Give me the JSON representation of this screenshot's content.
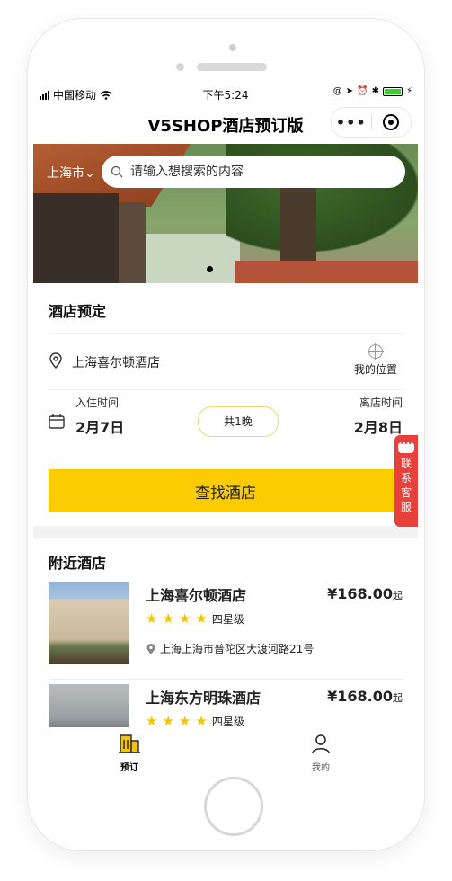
{
  "status_bar": {
    "carrier": "中国移动",
    "time": "下午5:24"
  },
  "navbar": {
    "title": "V5SHOP酒店预订版",
    "more_label": "•••"
  },
  "banner": {
    "city": "上海市",
    "search_placeholder": "请输入想搜索的内容"
  },
  "booking": {
    "section_title": "酒店预定",
    "hotel_name": "上海喜尔顿酒店",
    "my_location_label": "我的位置",
    "checkin_label": "入住时间",
    "checkin_date": "2月7日",
    "checkout_label": "离店时间",
    "checkout_date": "2月8日",
    "nights": "共1晚",
    "find_button": "查找酒店"
  },
  "nearby": {
    "section_title": "附近酒店",
    "hotels": [
      {
        "name": "上海喜尔顿酒店",
        "price": "¥168.00",
        "price_suffix": "起",
        "stars": 4,
        "grade": "四星级",
        "address": "上海上海市普陀区大渡河路21号"
      },
      {
        "name": "上海东方明珠酒店",
        "price": "¥168.00",
        "price_suffix": "起",
        "stars": 4,
        "grade": "四星级",
        "address": ""
      }
    ]
  },
  "tabbar": {
    "tabs": [
      {
        "label": "预订",
        "icon": "building-icon",
        "active": true
      },
      {
        "label": "我的",
        "icon": "user-icon",
        "active": false
      }
    ]
  },
  "service_button": {
    "label": "联系客服"
  },
  "colors": {
    "accent": "#fccb00",
    "service": "#e8403a",
    "star": "#f5c400"
  }
}
